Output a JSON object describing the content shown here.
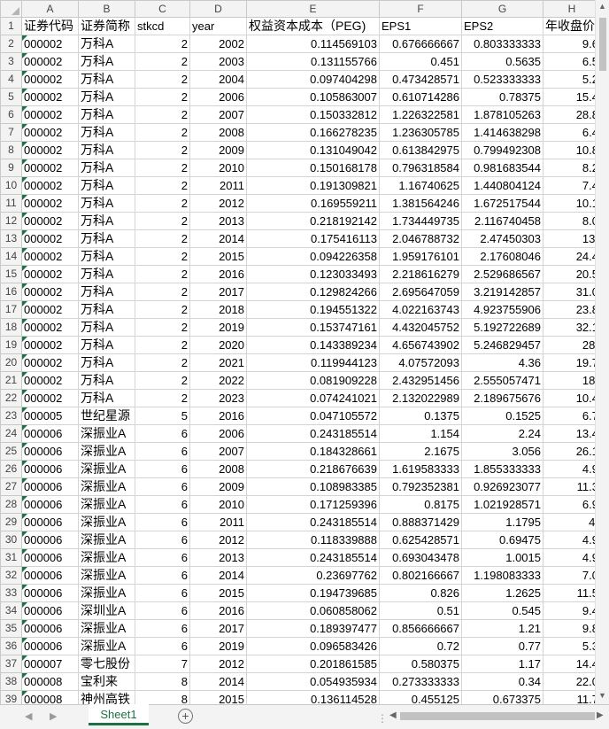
{
  "columns": [
    "A",
    "B",
    "C",
    "D",
    "E",
    "F",
    "G",
    "H"
  ],
  "header": [
    "证券代码",
    "证券简称",
    "stkcd",
    "year",
    "权益资本成本（PEG)",
    "EPS1",
    "EPS2",
    "年收盘价"
  ],
  "rows": [
    [
      "000002",
      "万科A",
      "2",
      "2002",
      "0.114569103",
      "0.676666667",
      "0.803333333",
      "9.6"
    ],
    [
      "000002",
      "万科A",
      "2",
      "2003",
      "0.131155766",
      "0.451",
      "0.5635",
      "6.5"
    ],
    [
      "000002",
      "万科A",
      "2",
      "2004",
      "0.097404298",
      "0.473428571",
      "0.523333333",
      "5.2"
    ],
    [
      "000002",
      "万科A",
      "2",
      "2006",
      "0.105863007",
      "0.610714286",
      "0.78375",
      "15.4"
    ],
    [
      "000002",
      "万科A",
      "2",
      "2007",
      "0.150332812",
      "1.226322581",
      "1.878105263",
      "28.8"
    ],
    [
      "000002",
      "万科A",
      "2",
      "2008",
      "0.166278235",
      "1.236305785",
      "1.414638298",
      "6.4"
    ],
    [
      "000002",
      "万科A",
      "2",
      "2009",
      "0.131049042",
      "0.613842975",
      "0.799492308",
      "10.8"
    ],
    [
      "000002",
      "万科A",
      "2",
      "2010",
      "0.150168178",
      "0.796318584",
      "0.981683544",
      "8.2"
    ],
    [
      "000002",
      "万科A",
      "2",
      "2011",
      "0.191309821",
      "1.16740625",
      "1.440804124",
      "7.4"
    ],
    [
      "000002",
      "万科A",
      "2",
      "2012",
      "0.169559211",
      "1.381564246",
      "1.672517544",
      "10.1"
    ],
    [
      "000002",
      "万科A",
      "2",
      "2013",
      "0.218192142",
      "1.734449735",
      "2.116740458",
      "8.0"
    ],
    [
      "000002",
      "万科A",
      "2",
      "2014",
      "0.175416113",
      "2.046788732",
      "2.47450303",
      "13."
    ],
    [
      "000002",
      "万科A",
      "2",
      "2015",
      "0.094226358",
      "1.959176101",
      "2.17608046",
      "24.4"
    ],
    [
      "000002",
      "万科A",
      "2",
      "2016",
      "0.123033493",
      "2.218616279",
      "2.529686567",
      "20.5"
    ],
    [
      "000002",
      "万科A",
      "2",
      "2017",
      "0.129824266",
      "2.695647059",
      "3.219142857",
      "31.0"
    ],
    [
      "000002",
      "万科A",
      "2",
      "2018",
      "0.194551322",
      "4.022163743",
      "4.923755906",
      "23.8"
    ],
    [
      "000002",
      "万科A",
      "2",
      "2019",
      "0.153747161",
      "4.432045752",
      "5.192722689",
      "32.1"
    ],
    [
      "000002",
      "万科A",
      "2",
      "2020",
      "0.143389234",
      "4.656743902",
      "5.246829457",
      "28."
    ],
    [
      "000002",
      "万科A",
      "2",
      "2021",
      "0.119944123",
      "4.07572093",
      "4.36",
      "19.7"
    ],
    [
      "000002",
      "万科A",
      "2",
      "2022",
      "0.081909228",
      "2.432951456",
      "2.555057471",
      "18."
    ],
    [
      "000002",
      "万科A",
      "2",
      "2023",
      "0.074241021",
      "2.132022989",
      "2.189675676",
      "10.4"
    ],
    [
      "000005",
      "世纪星源",
      "5",
      "2016",
      "0.047105572",
      "0.1375",
      "0.1525",
      "6.7"
    ],
    [
      "000006",
      "深振业A",
      "6",
      "2006",
      "0.243185514",
      "1.154",
      "2.24",
      "13.4"
    ],
    [
      "000006",
      "深振业A",
      "6",
      "2007",
      "0.184328661",
      "2.1675",
      "3.056",
      "26.1"
    ],
    [
      "000006",
      "深振业A",
      "6",
      "2008",
      "0.218676639",
      "1.619583333",
      "1.855333333",
      "4.9"
    ],
    [
      "000006",
      "深振业A",
      "6",
      "2009",
      "0.108983385",
      "0.792352381",
      "0.926923077",
      "11.3"
    ],
    [
      "000006",
      "深振业A",
      "6",
      "2010",
      "0.171259396",
      "0.8175",
      "1.021928571",
      "6.9"
    ],
    [
      "000006",
      "深振业A",
      "6",
      "2011",
      "0.243185514",
      "0.888371429",
      "1.1795",
      "4."
    ],
    [
      "000006",
      "深振业A",
      "6",
      "2012",
      "0.118339888",
      "0.625428571",
      "0.69475",
      "4.9"
    ],
    [
      "000006",
      "深振业A",
      "6",
      "2013",
      "0.243185514",
      "0.693043478",
      "1.0015",
      "4.9"
    ],
    [
      "000006",
      "深振业A",
      "6",
      "2014",
      "0.23697762",
      "0.802166667",
      "1.198083333",
      "7.0"
    ],
    [
      "000006",
      "深振业A",
      "6",
      "2015",
      "0.194739685",
      "0.826",
      "1.2625",
      "11.5"
    ],
    [
      "000006",
      "深圳业A",
      "6",
      "2016",
      "0.060858062",
      "0.51",
      "0.545",
      "9.4"
    ],
    [
      "000006",
      "深振业A",
      "6",
      "2017",
      "0.189397477",
      "0.856666667",
      "1.21",
      "9.8"
    ],
    [
      "000006",
      "深振业A",
      "6",
      "2019",
      "0.096583426",
      "0.72",
      "0.77",
      "5.3"
    ],
    [
      "000007",
      "零七股份",
      "7",
      "2012",
      "0.201861585",
      "0.580375",
      "1.17",
      "14.4"
    ],
    [
      "000008",
      "宝利来",
      "8",
      "2014",
      "0.054935934",
      "0.273333333",
      "0.34",
      "22.0"
    ],
    [
      "000008",
      "神州高铁",
      "8",
      "2015",
      "0.136114528",
      "0.455125",
      "0.673375",
      "11.7"
    ]
  ],
  "sheet_tab": "Sheet1",
  "add_sheet_symbol": "+",
  "accent_color": "#1e7145"
}
